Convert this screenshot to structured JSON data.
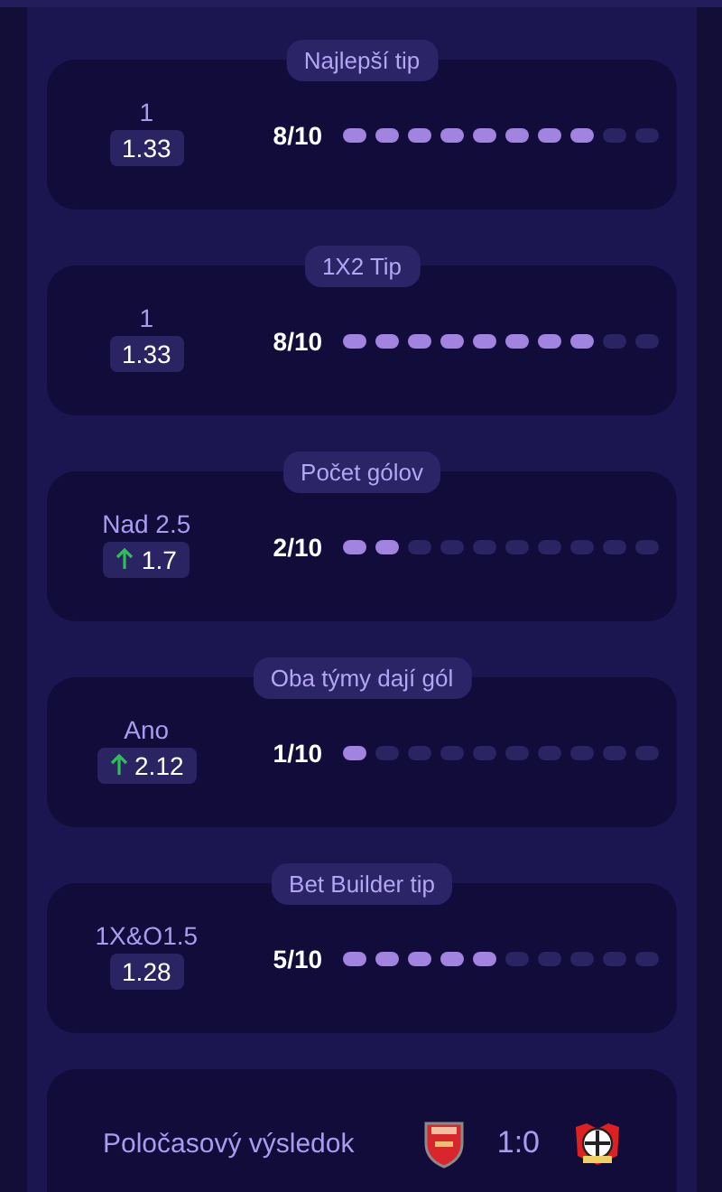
{
  "tips": [
    {
      "title": "Najlepší tip",
      "pick": "1",
      "odds": "1.33",
      "rising": false,
      "score": "8/10",
      "level": 0.8
    },
    {
      "title": "1X2 Tip",
      "pick": "1",
      "odds": "1.33",
      "rising": false,
      "score": "8/10",
      "level": 0.8
    },
    {
      "title": "Počet gólov",
      "pick": "Nad 2.5",
      "odds": "1.7",
      "rising": true,
      "score": "2/10",
      "level": 0.2
    },
    {
      "title": "Oba týmy dají gól",
      "pick": "Ano",
      "odds": "2.12",
      "rising": true,
      "score": "1/10",
      "level": 0.1
    },
    {
      "title": "Bet Builder tip",
      "pick": "1X&O1.5",
      "odds": "1.28",
      "rising": false,
      "score": "5/10",
      "level": 0.5
    }
  ],
  "halftime": {
    "label": "Poločasový výsledok",
    "score": "1:0"
  }
}
